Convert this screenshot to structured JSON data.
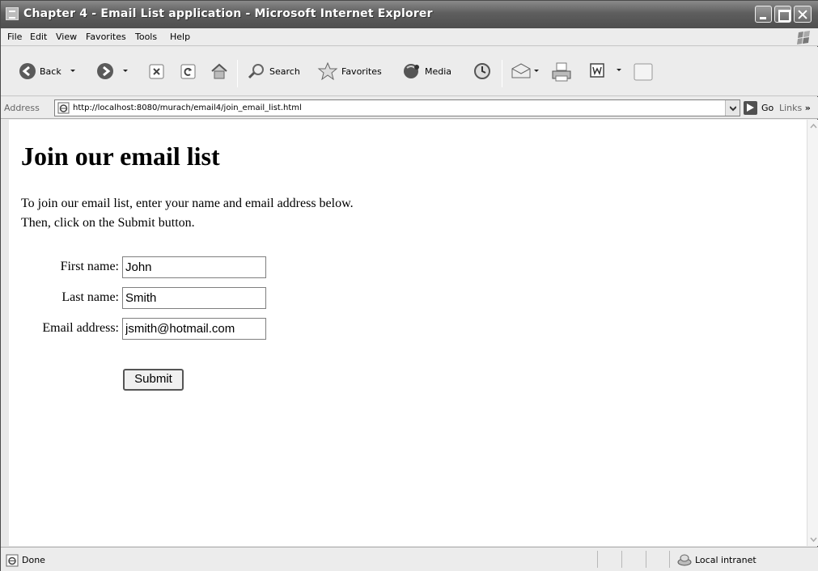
{
  "window": {
    "title": "Chapter 4 - Email List application - Microsoft Internet Explorer"
  },
  "menu": [
    "File",
    "Edit",
    "View",
    "Favorites",
    "Tools",
    "Help"
  ],
  "toolbar": {
    "back_label": "Back",
    "search_label": "Search",
    "favorites_label": "Favorites",
    "media_label": "Media"
  },
  "address": {
    "label": "Address",
    "url": "http://localhost:8080/murach/email4/join_email_list.html",
    "go_label": "Go",
    "links_label": "Links"
  },
  "page": {
    "heading": "Join our email list",
    "intro_line1": "To join our email list, enter your name and email address below.",
    "intro_line2": "Then, click on the Submit button.",
    "fields": [
      {
        "label": "First name:",
        "value": "John"
      },
      {
        "label": "Last name:",
        "value": "Smith"
      },
      {
        "label": "Email address:",
        "value": "jsmith@hotmail.com"
      }
    ],
    "submit_label": "Submit"
  },
  "status": {
    "text": "Done",
    "zone": "Local intranet"
  }
}
